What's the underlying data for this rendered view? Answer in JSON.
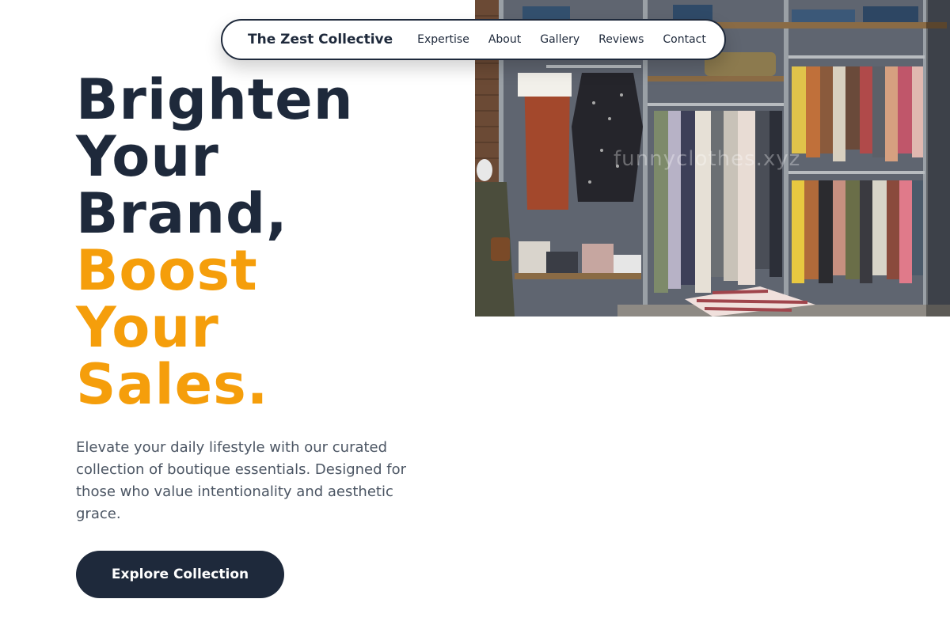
{
  "nav": {
    "brand": "The Zest Collective",
    "links": [
      {
        "label": "Expertise"
      },
      {
        "label": "About"
      },
      {
        "label": "Gallery"
      },
      {
        "label": "Reviews"
      },
      {
        "label": "Contact"
      }
    ]
  },
  "hero": {
    "headline_dark": [
      "Brighten",
      "Your",
      "Brand,"
    ],
    "headline_accent": [
      "Boost",
      "Your",
      "Sales."
    ],
    "description": "Elevate your daily lifestyle with our curated collection of boutique essentials. Designed for those who value intentionality and aesthetic grace.",
    "cta_label": "Explore Collection",
    "image_watermark": "funnyclothes.xyz"
  },
  "colors": {
    "primary": "#1e293b",
    "accent": "#f59e0b",
    "body_text": "#4b5563",
    "background": "#ffffff"
  }
}
